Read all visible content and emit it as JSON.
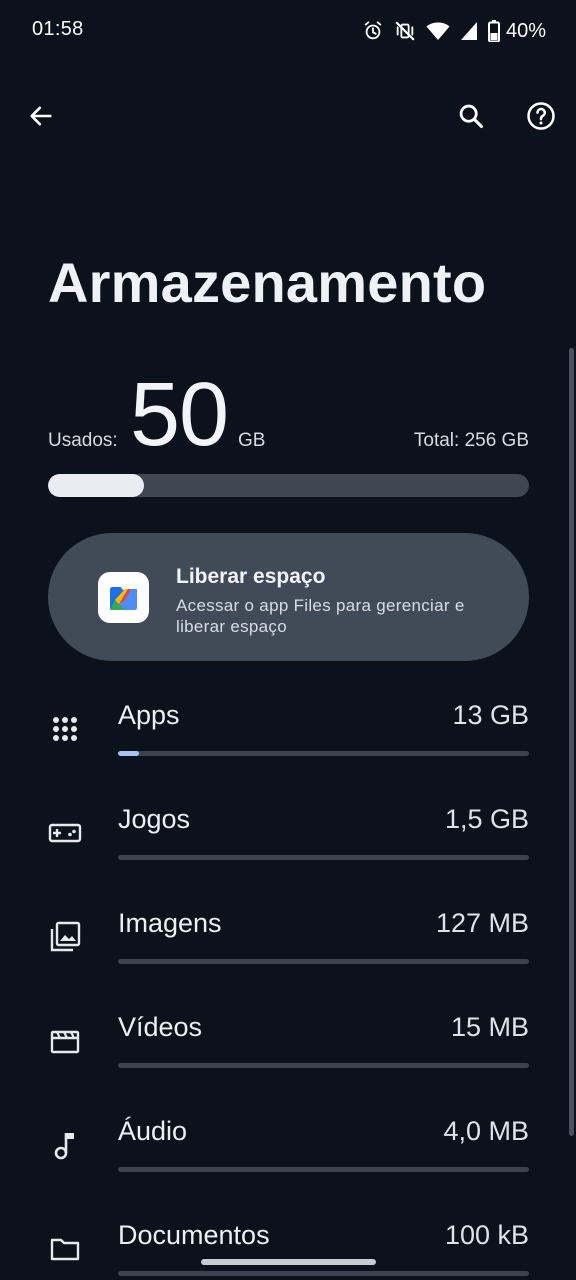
{
  "status_bar": {
    "time": "01:58",
    "battery": "40%"
  },
  "header": {
    "back_icon": "arrow-back-icon",
    "search_icon": "search-icon",
    "help_icon": "help-circle-icon"
  },
  "page": {
    "title": "Armazenamento"
  },
  "summary": {
    "used_label": "Usados:",
    "used_value": "50",
    "used_unit": "GB",
    "total_label": "Total: 256 GB",
    "used_fraction": 0.2
  },
  "free_up": {
    "title": "Liberar espaço",
    "subtitle": "Acessar o app Files para gerenciar e liberar espaço"
  },
  "categories": [
    {
      "label": "Apps",
      "size": "13 GB",
      "icon": "apps-grid-icon",
      "fraction": 0.05
    },
    {
      "label": "Jogos",
      "size": "1,5 GB",
      "icon": "gamepad-icon",
      "fraction": 0.0
    },
    {
      "label": "Imagens",
      "size": "127 MB",
      "icon": "photo-library-icon",
      "fraction": 0.0
    },
    {
      "label": "Vídeos",
      "size": "15 MB",
      "icon": "movie-icon",
      "fraction": 0.0
    },
    {
      "label": "Áudio",
      "size": "4,0 MB",
      "icon": "music-note-icon",
      "fraction": 0.0
    },
    {
      "label": "Documentos",
      "size": "100 kB",
      "icon": "folder-icon",
      "fraction": 0.0
    }
  ],
  "colors": {
    "background": "#0b121c",
    "card": "#414a57",
    "accent": "#a8c4f5",
    "track": "#3c434e"
  }
}
